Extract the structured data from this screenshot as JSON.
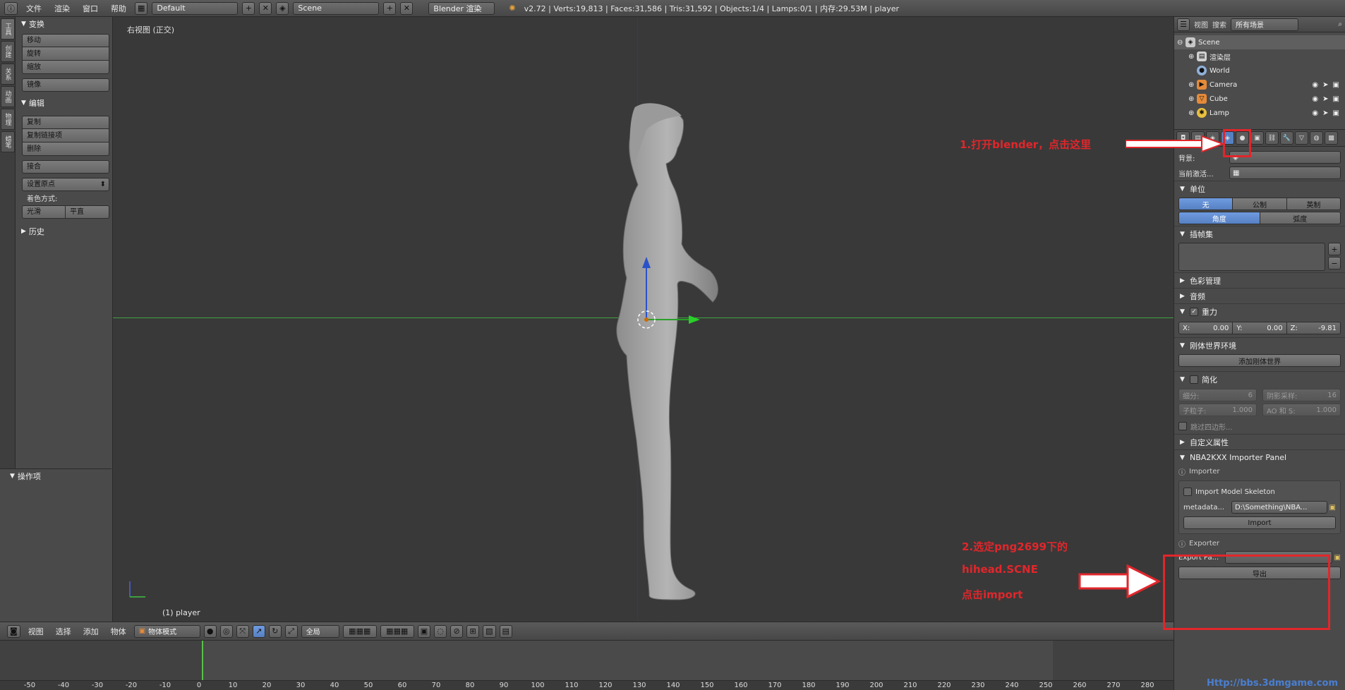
{
  "top_header": {
    "menus": [
      "文件",
      "渲染",
      "窗口",
      "帮助"
    ],
    "layout": "Default",
    "scene": "Scene",
    "render_engine": "Blender 渲染",
    "stats": "v2.72 | Verts:19,813 | Faces:31,586 | Tris:31,592 | Objects:1/4 | Lamps:0/1 | 内存:29.53M | player"
  },
  "tool_shelf": {
    "tabs": [
      "工具",
      "创建",
      "关系",
      "动画",
      "物理",
      "蜡笔"
    ],
    "transform": {
      "title": "变换",
      "buttons": [
        "移动",
        "旋转",
        "缩放"
      ],
      "mirror": "镜像"
    },
    "edit": {
      "title": "编辑",
      "buttons": [
        "复制",
        "复制链接项",
        "删除"
      ],
      "join": "接合",
      "set_origin": "设置原点",
      "shading_label": "着色方式:",
      "smooth": "光滑",
      "flat": "平直"
    },
    "history": "历史",
    "operator": "操作项"
  },
  "viewport": {
    "view_label": "右视图 (正交)",
    "object_label": "(1) player"
  },
  "outliner": {
    "view_menu": "视图",
    "search_menu": "搜索",
    "scope": "所有场景",
    "items": [
      {
        "name": "Scene",
        "icon": "scene-icon"
      },
      {
        "name": "渲染层",
        "icon": "render-layer-icon"
      },
      {
        "name": "World",
        "icon": "world-icon"
      },
      {
        "name": "Camera",
        "icon": "camera-icon"
      },
      {
        "name": "Cube",
        "icon": "cube-icon"
      },
      {
        "name": "Lamp",
        "icon": "lamp-icon"
      }
    ]
  },
  "properties": {
    "background_label": "背景:",
    "active_clip_label": "当前激活...",
    "units": {
      "title": "单位",
      "systems": [
        "无",
        "公制",
        "英制"
      ],
      "rotation": [
        "角度",
        "弧度"
      ]
    },
    "keying_sets": "插帧集",
    "color_management": "色彩管理",
    "audio": "音频",
    "gravity": {
      "title": "重力",
      "x_label": "X:",
      "x": "0.00",
      "y_label": "Y:",
      "y": "0.00",
      "z_label": "Z:",
      "z": "-9.81"
    },
    "rigid_world": {
      "title": "刚体世界环境",
      "button": "添加刚体世界"
    },
    "simplify": {
      "title": "简化",
      "subdiv_label": "细分:",
      "subdiv": "6",
      "shadow_label": "阴影采样:",
      "shadow": "16",
      "child_label": "子粒子:",
      "child": "1.000",
      "ao_label": "AO 和 S:",
      "ao": "1.000",
      "skip_quad": "跳过四边形..."
    },
    "custom_props": "自定义属性",
    "nba_panel": {
      "title": "NBA2KXX Importer Panel",
      "importer": "Importer",
      "import_skeleton": "Import Model Skeleton",
      "metadata_label": "metadata...",
      "metadata_path": "D:\\Something\\NBA...",
      "import_button": "Import",
      "exporter": "Exporter",
      "export_label": "Export Pa...",
      "export_button": "导出"
    }
  },
  "bottom_header": {
    "menus": [
      "视图",
      "选择",
      "添加",
      "物体"
    ],
    "mode": "物体模式",
    "pivot": "全局"
  },
  "timeline": {
    "ticks": [
      "-50",
      "-40",
      "-30",
      "-20",
      "-10",
      "0",
      "10",
      "20",
      "30",
      "40",
      "50",
      "60",
      "70",
      "80",
      "90",
      "100",
      "110",
      "120",
      "130",
      "140",
      "150",
      "160",
      "170",
      "180",
      "190",
      "200",
      "210",
      "220",
      "230",
      "240",
      "250",
      "260",
      "270",
      "280"
    ]
  },
  "annotations": {
    "step1": "1.打开blender，点击这里",
    "step2_line1": "2.选定png2699下的",
    "step2_line2": "hihead.SCNE",
    "step2_line3": "点击import"
  },
  "colors": {
    "annotation": "#e1262b",
    "accent": "#5680c2",
    "x_axis": "#3fa33f",
    "z_axis": "#2f2fae"
  },
  "watermark": "Http://bbs.3dmgame.com"
}
